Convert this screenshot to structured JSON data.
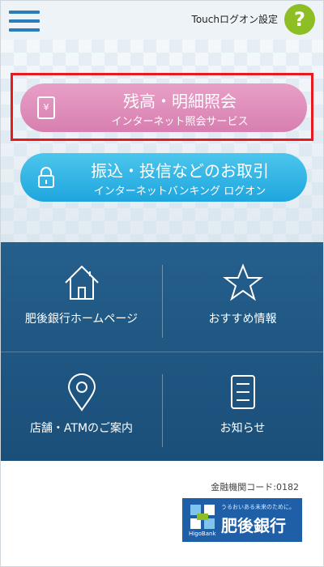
{
  "header": {
    "touch_logon": "Touchログオン設定",
    "help": "?"
  },
  "buttons": {
    "balance": {
      "title": "残高・明細照会",
      "subtitle": "インターネット照会サービス",
      "icon": "yen-receipt-icon",
      "color": "#d77fb0"
    },
    "transfer": {
      "title": "振込・投信などのお取引",
      "subtitle": "インターネットバンキング ログオン",
      "icon": "lock-icon",
      "color": "#1fa5de"
    }
  },
  "grid": [
    {
      "label": "肥後銀行ホームページ",
      "icon": "home-icon"
    },
    {
      "label": "おすすめ情報",
      "icon": "star-icon"
    },
    {
      "label": "店舗・ATMのご案内",
      "icon": "map-pin-icon"
    },
    {
      "label": "お知らせ",
      "icon": "notice-icon"
    }
  ],
  "footer": {
    "institution_code": "金融機関コード:0182",
    "logo": {
      "tagline": "うるおいある未来のために。",
      "name": "肥後銀行",
      "en": "HigoBank"
    }
  },
  "colors": {
    "accent": "#2a7db8",
    "help_green": "#8dbf25",
    "grid_bg": "#1a4f79",
    "highlight": "#e51b20"
  }
}
